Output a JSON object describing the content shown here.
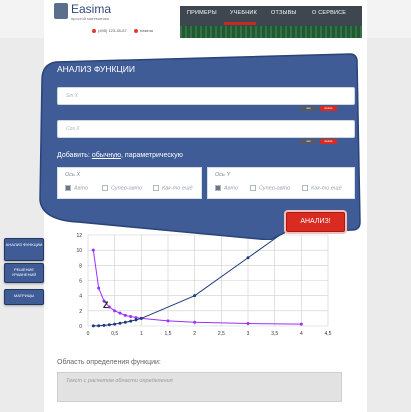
{
  "header": {
    "logo_title": "Easima",
    "logo_sub": "простой математика",
    "phone": "(495) 123-45-67",
    "skype": "easima",
    "nav": [
      "ПРИМЕРЫ",
      "УЧЕБНИК",
      "ОТЗЫВЫ",
      "О СЕРВИСЕ"
    ],
    "active_nav": "УЧЕБНИК"
  },
  "sidebar": {
    "items": [
      "АНАЛИЗ ФУНКЦИИ",
      "РЕШЕНИЕ УРАВНЕНИЙ",
      "МАТРИЦЫ"
    ]
  },
  "panel": {
    "title": "АНАЛИЗ ФУНКЦИИ",
    "input1_placeholder": "Sin X",
    "input2_placeholder": "Cos X",
    "mini_set": "set",
    "mini_delete": "delete",
    "add_label": "Добавить:",
    "add_link1": "обычную",
    "add_link2": ", параметрическую",
    "axis_x": {
      "title": "Ось X",
      "options": [
        "Авто",
        "Супер-авто",
        "Как-то ещё"
      ]
    },
    "axis_y": {
      "title": "Ось Y",
      "options": [
        "Авто",
        "Супер-авто",
        "Как-то ещё"
      ]
    },
    "analyze_button": "АНАЛИЗ!"
  },
  "colors": {
    "panel": "#3f5c96",
    "accent": "#d92b1f",
    "series1": "#9b30ff",
    "series2": "#1c3b78"
  },
  "chart_data": {
    "type": "line",
    "xlim": [
      0,
      4.5
    ],
    "ylim": [
      0,
      12
    ],
    "xticks": [
      "0",
      "0,5",
      "1",
      "1,5",
      "2",
      "2,5",
      "3",
      "3,5",
      "4",
      "4,5"
    ],
    "yticks": [
      "0",
      "2",
      "4",
      "6",
      "8",
      "10",
      "12"
    ],
    "annotation": "Z",
    "grid": true,
    "series": [
      {
        "x": [
          0.1,
          0.2,
          0.3,
          0.4,
          0.5,
          0.6,
          0.7,
          0.8,
          0.9,
          1.0,
          1.5,
          2.0,
          3.0,
          4.0
        ],
        "y": [
          10,
          5,
          3.3,
          2.5,
          2,
          1.7,
          1.4,
          1.25,
          1.1,
          1.0,
          0.67,
          0.5,
          0.33,
          0.25
        ]
      },
      {
        "x": [
          0.1,
          0.2,
          0.3,
          0.4,
          0.5,
          0.6,
          0.7,
          0.8,
          0.9,
          1.0,
          2.0,
          3.0,
          3.6
        ],
        "y": [
          0.01,
          0.04,
          0.09,
          0.16,
          0.25,
          0.36,
          0.49,
          0.64,
          0.81,
          1.0,
          4.0,
          9.0,
          12.96
        ]
      }
    ]
  },
  "domain_section": {
    "title": "Область определения функции:",
    "placeholder": "Текст с расчетом области определения"
  }
}
